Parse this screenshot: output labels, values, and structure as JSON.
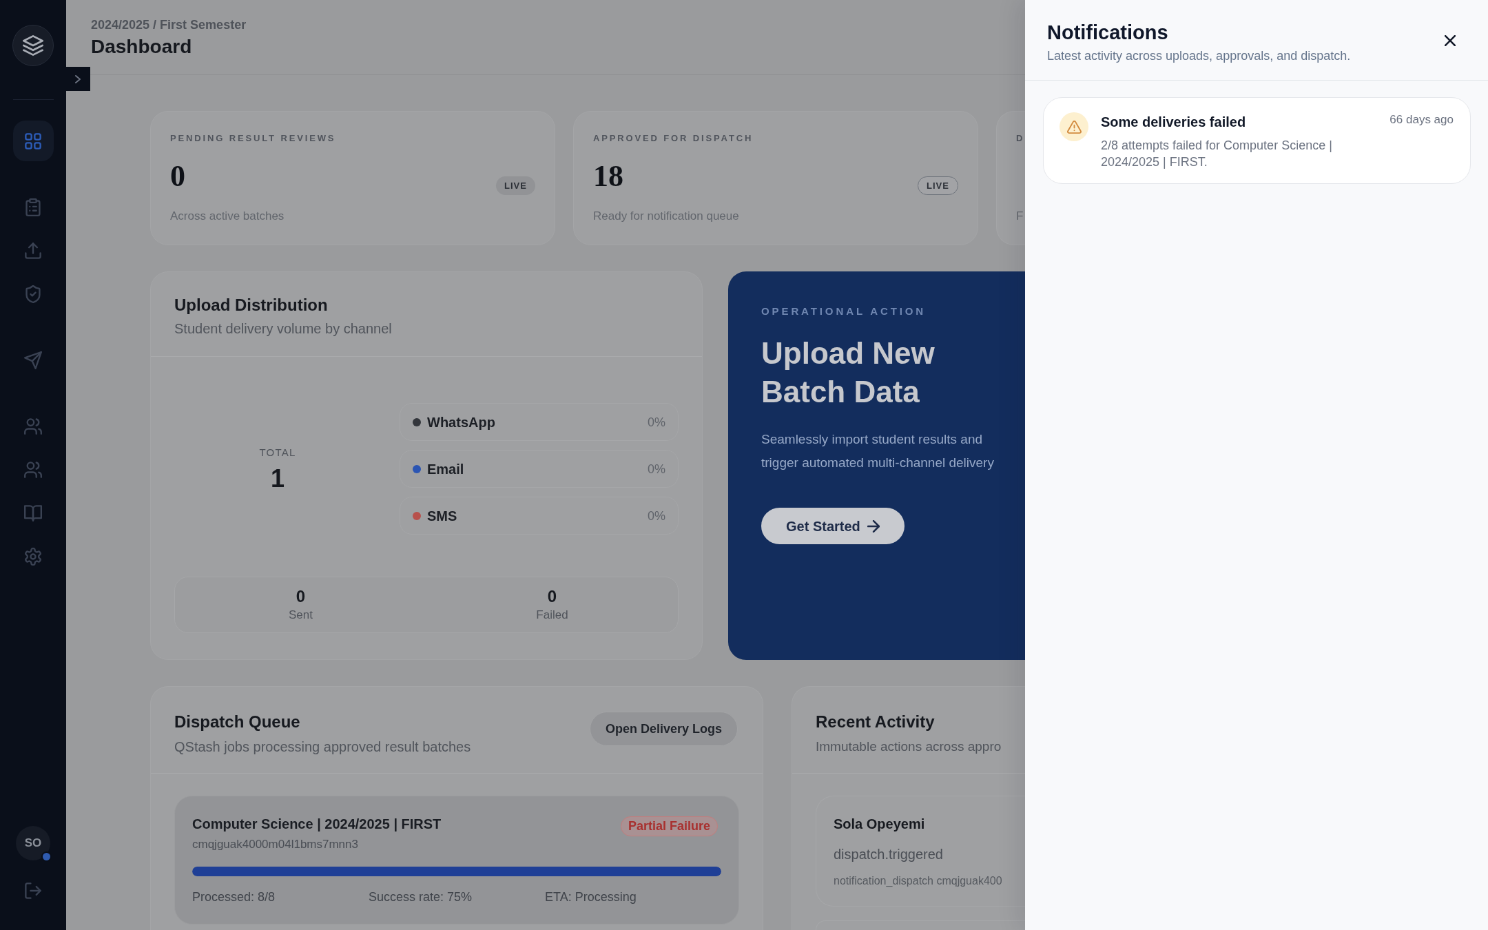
{
  "sidebar": {
    "expanded": false,
    "nav_groups": [
      {
        "items": [
          {
            "selected": true
          }
        ]
      },
      {
        "items": [
          {
            "selected": false
          },
          {
            "selected": false
          },
          {
            "selected": false
          }
        ]
      },
      {
        "items": [
          {
            "selected": false
          }
        ]
      },
      {
        "items": [
          {
            "selected": false
          },
          {
            "selected": false
          },
          {
            "selected": false
          },
          {
            "selected": false
          }
        ]
      }
    ],
    "user": {
      "initials": "SO",
      "online": true
    }
  },
  "header": {
    "breadcrumb": "2024/2025 / First Semester",
    "title": "Dashboard"
  },
  "stats": [
    {
      "label": "PENDING RESULT REVIEWS",
      "value": "0",
      "badge": {
        "text": "LIVE",
        "outlined": false
      },
      "caption": "Across active batches"
    },
    {
      "label": "APPROVED FOR DISPATCH",
      "value": "18",
      "badge": {
        "text": "LIVE",
        "outlined": true
      },
      "caption": "Ready for notification queue"
    },
    {
      "label": "D",
      "caption": "F"
    }
  ],
  "upload_distribution": {
    "title": "Upload Distribution",
    "subtitle": "Student delivery volume by channel",
    "total_label": "TOTAL",
    "total": "1",
    "channels": [
      {
        "name": "WhatsApp",
        "percent": "0%",
        "color": "#33363c"
      },
      {
        "name": "Email",
        "percent": "0%",
        "color": "#2b55b3"
      },
      {
        "name": "SMS",
        "percent": "0%",
        "color": "#b8514c"
      }
    ],
    "summary": [
      {
        "value": "0",
        "label": "Sent"
      },
      {
        "value": "0",
        "label": "Failed"
      }
    ]
  },
  "operational_action": {
    "eyebrow": "OPERATIONAL ACTION",
    "title": "Upload New Batch Data",
    "description": "Seamlessly import student results and trigger automated multi-channel delivery",
    "button": "Get Started"
  },
  "dispatch_queue": {
    "title": "Dispatch Queue",
    "subtitle": "QStash jobs processing approved result batches",
    "action": "Open Delivery Logs",
    "jobs": [
      {
        "title": "Computer Science | 2024/2025 | FIRST",
        "id": "cmqjguak4000m04l1bms7mnn3",
        "status": {
          "text": "Partial Failure",
          "kind": "danger"
        },
        "level": 1,
        "stats": [
          "Processed: 8/8",
          "Success rate: 75%",
          "ETA: Processing"
        ]
      }
    ]
  },
  "recent_activity": {
    "title": "Recent Activity",
    "subtitle": "Immutable actions across appro",
    "entries": [
      {
        "actor": "Sola Opeyemi",
        "action": "dispatch.triggered",
        "detail": "notification_dispatch cmqjguak400"
      }
    ]
  },
  "notifications": {
    "title": "Notifications",
    "subtitle": "Latest activity across uploads, approvals, and dispatch.",
    "items": [
      {
        "kind": "warning",
        "title": "Some deliveries failed",
        "message": "2/8 attempts failed for Computer Science | 2024/2025 | FIRST.",
        "time": "66 days ago"
      }
    ]
  }
}
